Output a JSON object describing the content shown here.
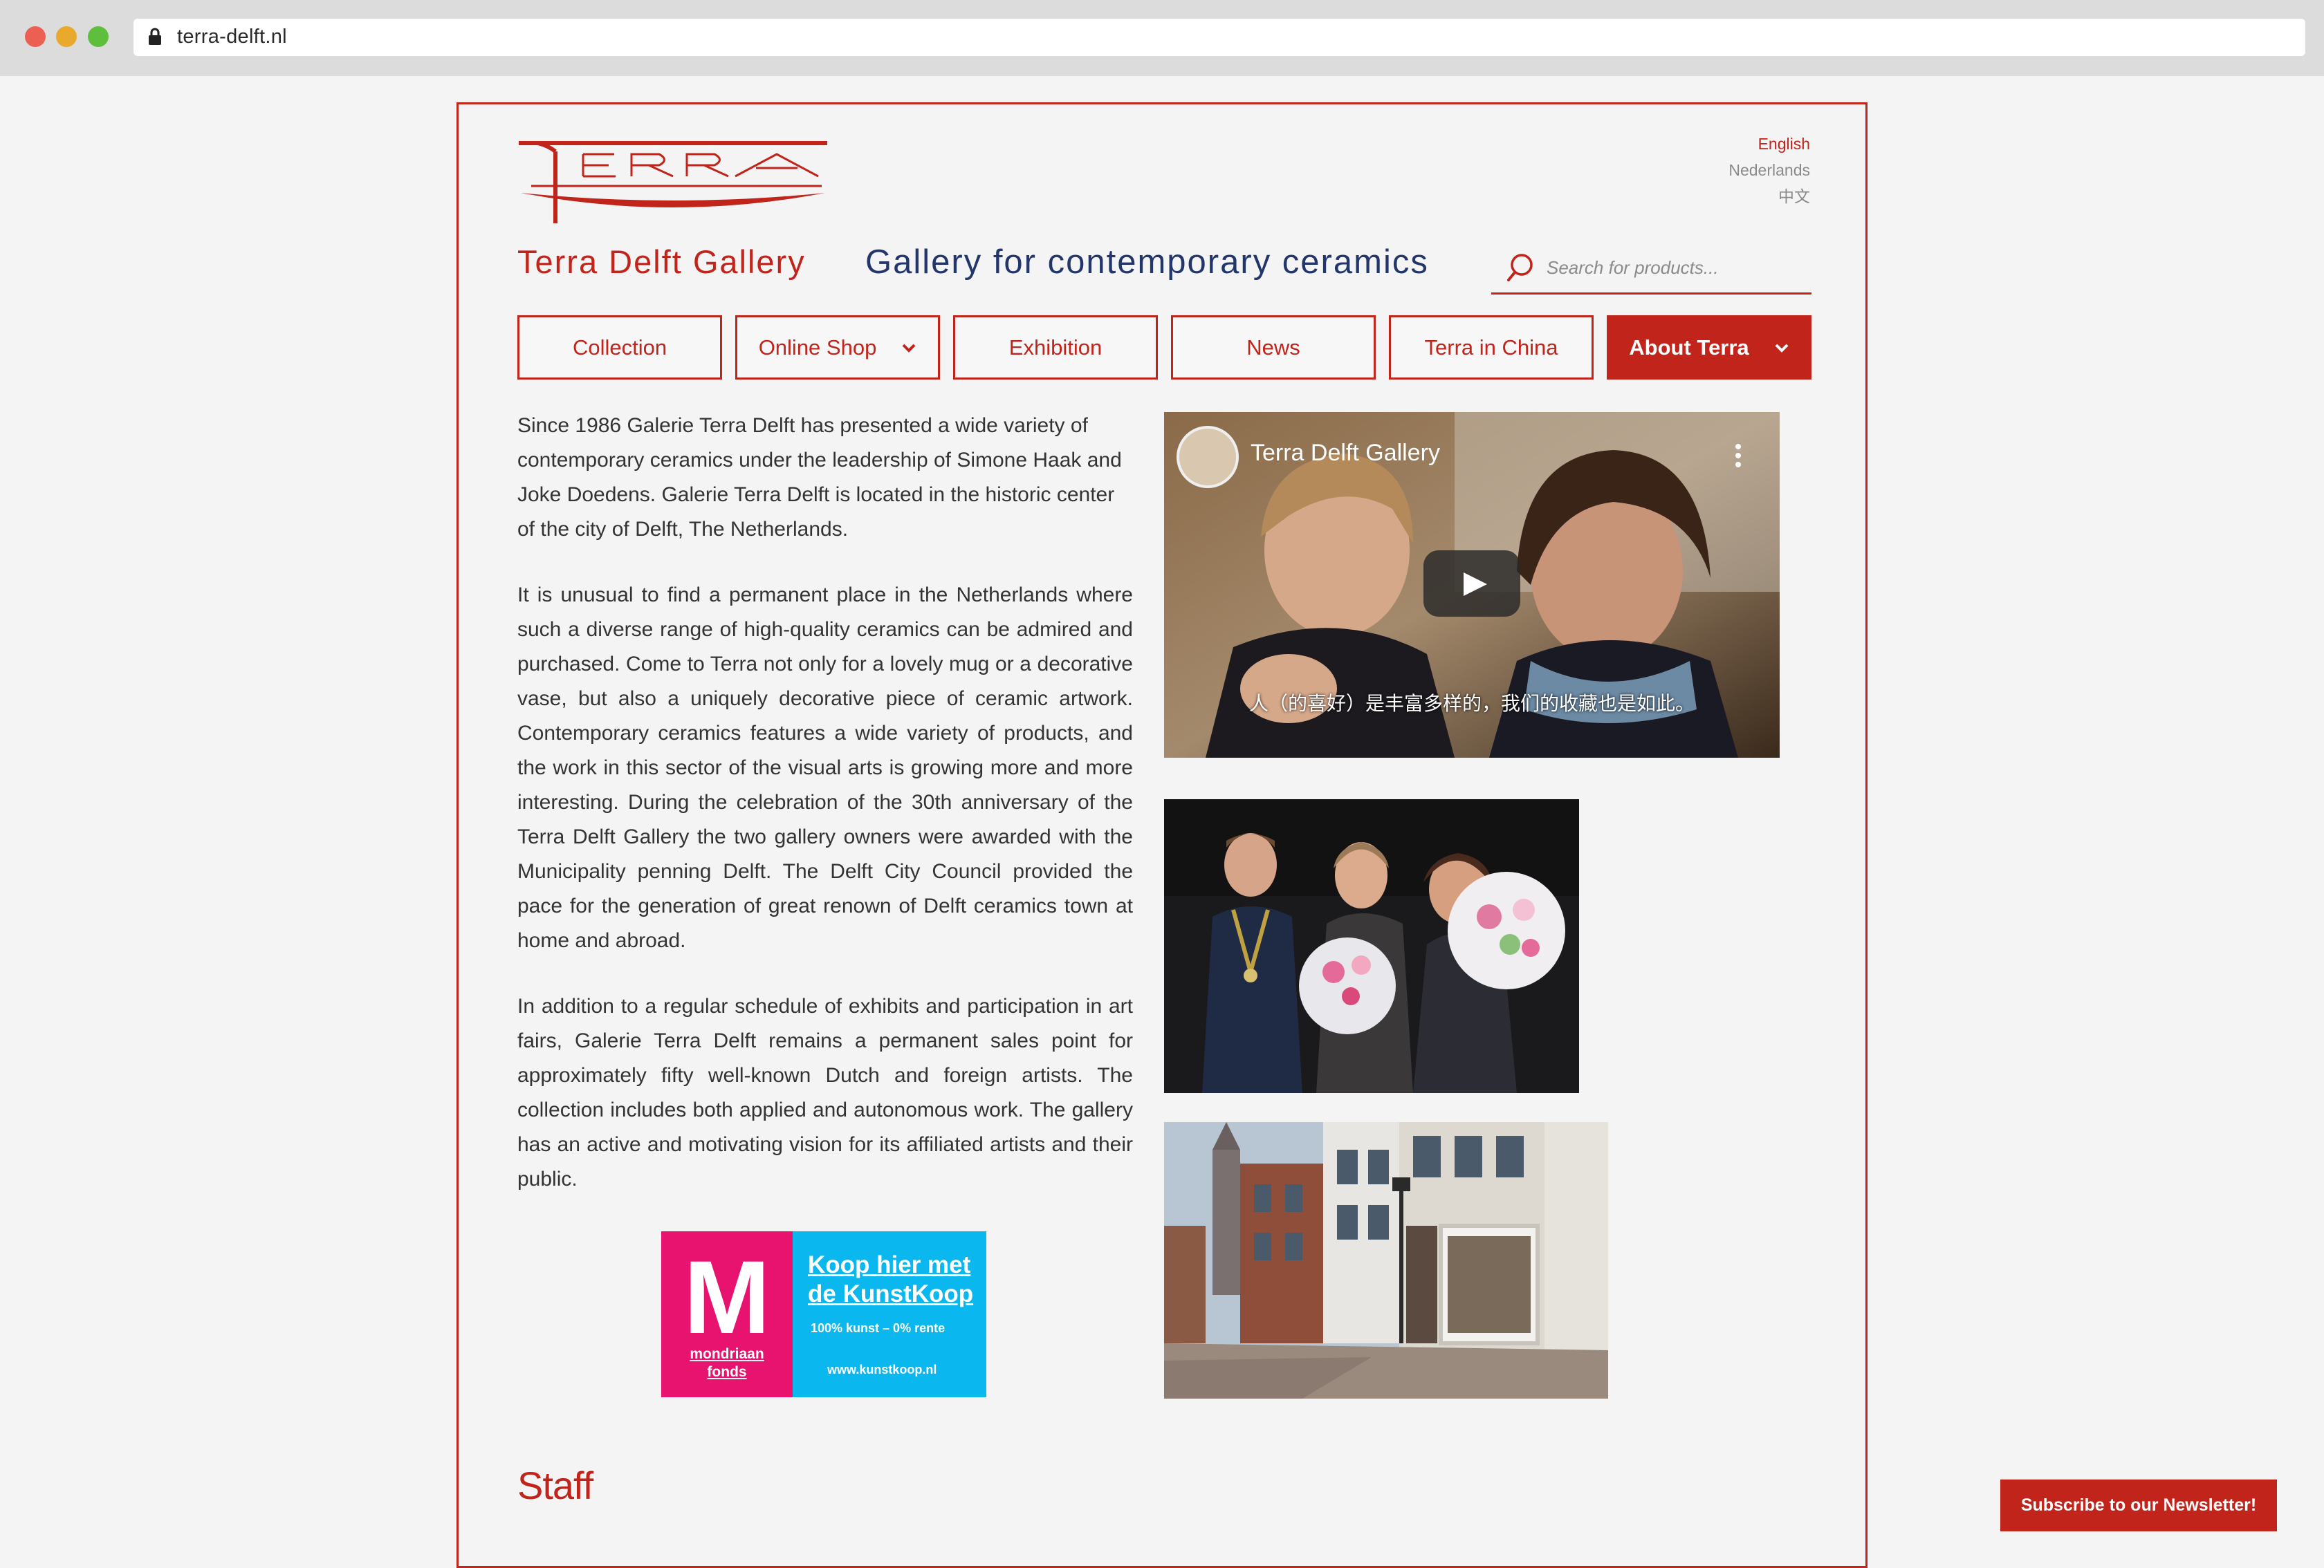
{
  "browser": {
    "url": "terra-delft.nl"
  },
  "header": {
    "brand_name": "Terra Delft Gallery",
    "tagline": "Gallery for contemporary ceramics",
    "logo_text": "TERRA",
    "languages": [
      "English",
      "Nederlands",
      "中文"
    ],
    "active_language": "English"
  },
  "search": {
    "placeholder": "Search for products..."
  },
  "nav": {
    "items": [
      {
        "label": "Collection",
        "has_dropdown": false,
        "active": false
      },
      {
        "label": "Online Shop",
        "has_dropdown": true,
        "active": false
      },
      {
        "label": "Exhibition",
        "has_dropdown": false,
        "active": false
      },
      {
        "label": "News",
        "has_dropdown": false,
        "active": false
      },
      {
        "label": "Terra in China",
        "has_dropdown": false,
        "active": false
      },
      {
        "label": "About Terra",
        "has_dropdown": true,
        "active": true
      }
    ]
  },
  "content": {
    "paragraphs": [
      "Since 1986 Galerie Terra Delft has presented a wide variety of contemporary ceramics under the leadership of Simone Haak and Joke Doedens. Galerie Terra Delft is located in the historic center of the city of Delft, The Netherlands.",
      "It is unusual to find a permanent place in the Netherlands where such a diverse range of high-quality ceramics can be admired and purchased. Come to Terra not only for a lovely mug or a decorative vase, but also a uniquely decorative piece of ceramic artwork. Contemporary ceramics features a wide variety of products, and the work in this sector of the visual arts is growing more and more interesting. During the celebration of the 30th anniversary of the Terra Delft Gallery the two gallery owners were awarded with the Municipality penning Delft. The Delft City Council provided the pace for the generation of great renown of Delft ceramics town at home and abroad.",
      "In addition to a regular schedule of exhibits and participation in art fairs, Galerie Terra Delft remains a permanent sales point for approximately fifty well-known Dutch and foreign artists. The collection includes both applied and autonomous work. The gallery has an active and motivating vision for its affiliated artists and their public."
    ],
    "staff_heading": "Staff"
  },
  "kunstkoop": {
    "logo_letter": "M",
    "fonds_line1": "mondriaan",
    "fonds_line2": "fonds",
    "title": "Koop hier met de KunstKoop",
    "subtitle": "100% kunst – 0% rente",
    "url": "www.kunstkoop.nl"
  },
  "video": {
    "title": "Terra Delft Gallery",
    "subtitle": "人（的喜好）是丰富多样的，我们的收藏也是如此。"
  },
  "newsletter": {
    "label": "Subscribe to our Newsletter!"
  },
  "colors": {
    "brand_red": "#c0241b",
    "tagline_blue": "#22366b",
    "kunstkoop_pink": "#e8136e",
    "kunstkoop_blue": "#0ab7ee"
  }
}
